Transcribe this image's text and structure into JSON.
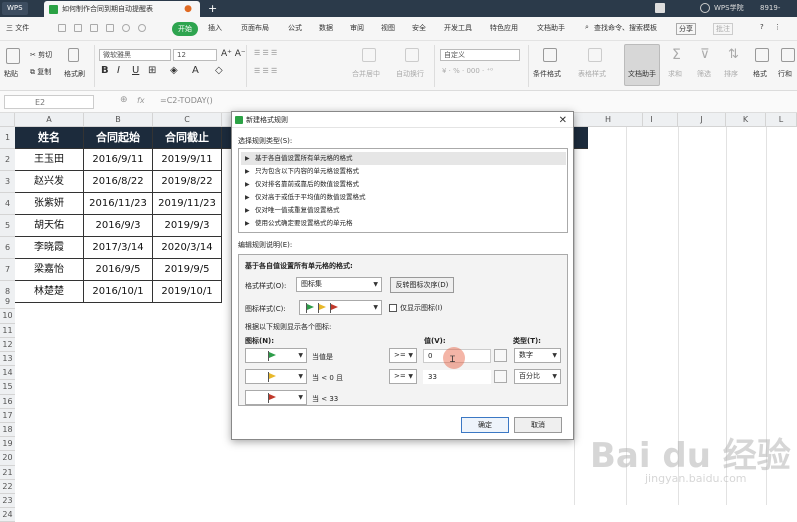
{
  "titlebar": {
    "app_tab": "WPS",
    "doc_tab": "如何制作合同到期自动提醒表",
    "user": "WPS学院",
    "user_id": "8919-"
  },
  "menu": {
    "file": "三 文件",
    "start": "开始",
    "items": [
      "插入",
      "页面布局",
      "公式",
      "数据",
      "审阅",
      "视图",
      "安全",
      "开发工具",
      "特色应用",
      "文档助手"
    ],
    "search": "查找命令、搜索模板",
    "share": "分享",
    "annotate": "批注"
  },
  "ribbon": {
    "paste": "粘贴",
    "cut": "剪切",
    "copy": "复制",
    "format_painter": "格式刷",
    "font_name": "微软雅黑",
    "font_size": "12",
    "merge": "合并居中",
    "wrap": "自动换行",
    "number_format": "自定义",
    "cond_format": "条件格式",
    "table_style": "表格样式",
    "doc_helper": "文档助手",
    "sum": "求和",
    "filter": "筛选",
    "sort": "排序",
    "format": "格式",
    "row_col": "行和"
  },
  "formula_bar": {
    "cell_ref": "E2",
    "fx": "fx",
    "formula": "=C2-TODAY()"
  },
  "sheet": {
    "columns": [
      "A",
      "B",
      "C",
      "D",
      "E",
      "F",
      "G",
      "H",
      "I",
      "J",
      "K",
      "L"
    ],
    "header": [
      "姓名",
      "合同起始",
      "合同截止"
    ],
    "rows": [
      [
        "王玉田",
        "2016/9/11",
        "2019/9/11"
      ],
      [
        "赵兴发",
        "2016/8/22",
        "2019/8/22"
      ],
      [
        "张紫妍",
        "2016/11/23",
        "2019/11/23"
      ],
      [
        "胡天佑",
        "2016/9/3",
        "2019/9/3"
      ],
      [
        "李晓霞",
        "2017/3/14",
        "2020/3/14"
      ],
      [
        "梁嘉怡",
        "2016/9/5",
        "2019/9/5"
      ],
      [
        "林楚楚",
        "2016/10/1",
        "2019/10/1"
      ]
    ],
    "row_numbers": [
      "1",
      "2",
      "3",
      "4",
      "5",
      "6",
      "7",
      "8",
      "9",
      "10",
      "11",
      "12",
      "13",
      "14",
      "15",
      "16",
      "17",
      "18",
      "19",
      "20",
      "21",
      "22",
      "23",
      "24"
    ]
  },
  "dialog": {
    "title": "新建格式规则",
    "rule_type_label": "选择规则类型(S):",
    "rule_types": [
      "基于各自值设置所有单元格的格式",
      "只为包含以下内容的单元格设置格式",
      "仅对排名靠前或靠后的数值设置格式",
      "仅对高于或低于平均值的数值设置格式",
      "仅对唯一值或重复值设置格式",
      "使用公式确定要设置格式的单元格"
    ],
    "selected_rule_index": 0,
    "edit_label": "编辑规则说明(E):",
    "desc_title": "基于各自值设置所有单元格的格式:",
    "format_style_label": "格式样式(O):",
    "format_style_value": "图标集",
    "reverse_button": "反转图标次序(D)",
    "icon_style_label": "图标样式(C):",
    "icon_only_label": "仅显示图标(I)",
    "rules_hint": "根据以下规则显示各个图标:",
    "col_icon": "图标(N):",
    "col_value": "值(V):",
    "col_type": "类型(T):",
    "icon_rules": [
      {
        "cond": "当值是",
        "op": ">=",
        "value": "0",
        "type": "数字",
        "flag_color": "#2e9d4a"
      },
      {
        "cond": "当 < 0 且",
        "op": ">=",
        "value": "33",
        "type": "百分比",
        "flag_color": "#e8b82a"
      },
      {
        "cond": "当 < 33",
        "op": "",
        "value": "",
        "type": "",
        "flag_color": "#c0392b"
      }
    ],
    "ok": "确定",
    "cancel": "取消"
  },
  "watermark": {
    "brand": "Bai du 经验",
    "url": "jingyan.baidu.com"
  }
}
